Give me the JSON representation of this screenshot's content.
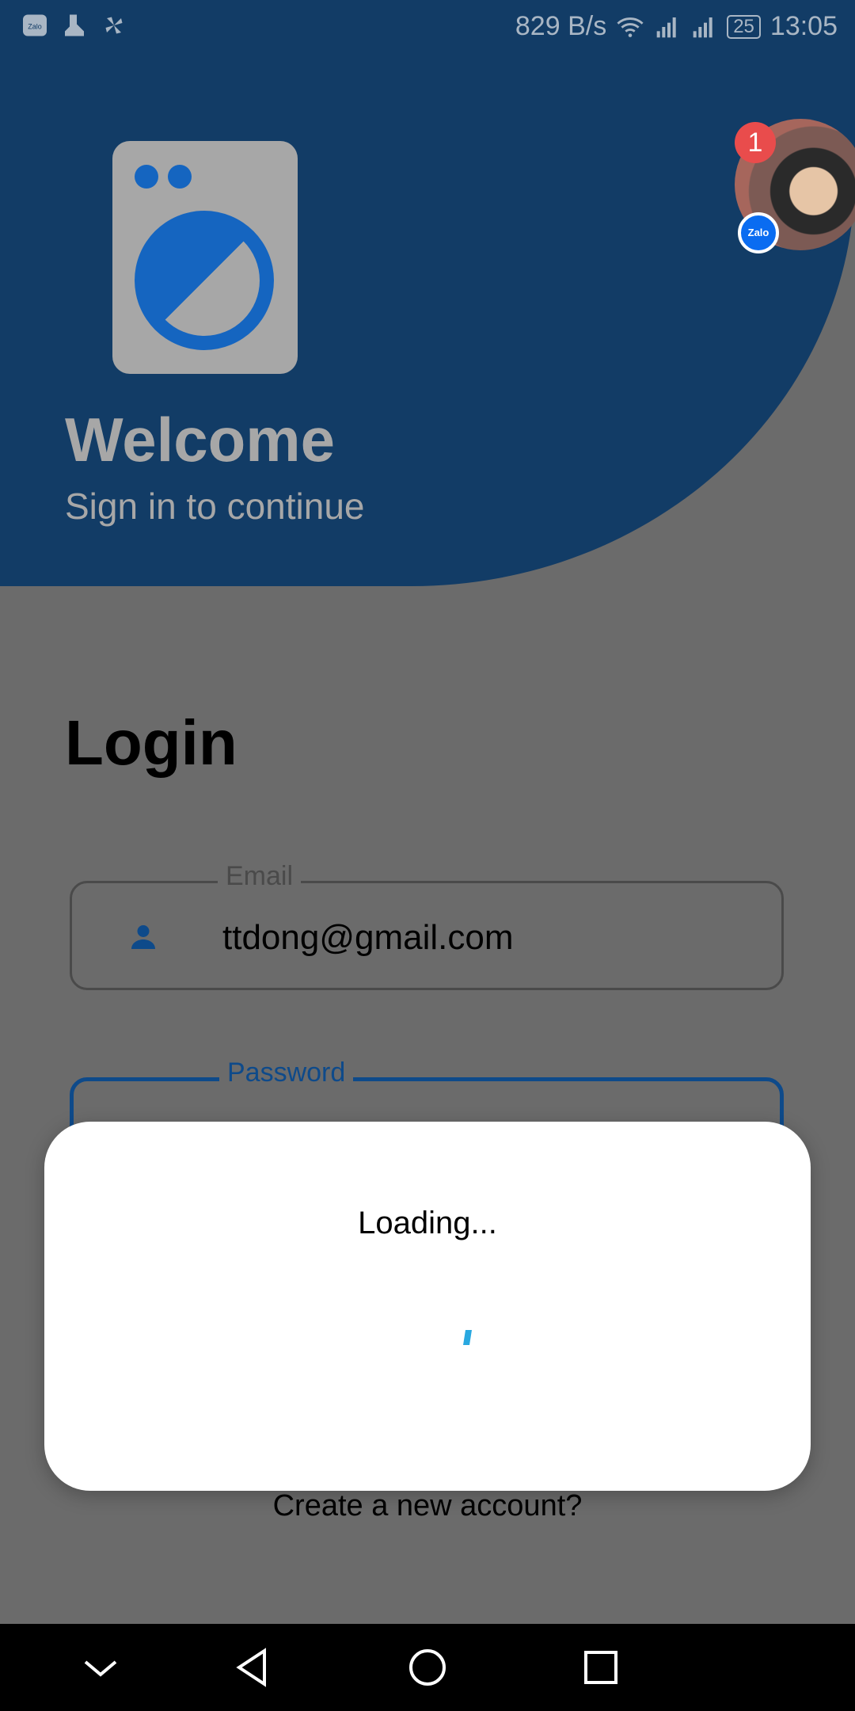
{
  "status_bar": {
    "net_speed": "829 B/s",
    "battery": "25",
    "time": "13:05",
    "left_icons": [
      "zalo-icon",
      "app-icon",
      "fan-icon"
    ],
    "right_icons": [
      "wifi-icon",
      "signal-icon",
      "signal-icon",
      "battery-icon"
    ]
  },
  "hero": {
    "title": "Welcome",
    "subtitle": "Sign in to continue"
  },
  "login": {
    "title": "Login",
    "email_label": "Email",
    "email_value": "ttdong@gmail.com",
    "password_label": "Password",
    "create_account": "Create a new account?"
  },
  "chathead": {
    "badge_count": "1",
    "app_label": "Zalo"
  },
  "dialog": {
    "message": "Loading..."
  },
  "colors": {
    "primary": "#1565c0",
    "scrim_gray": "#6b6b6b",
    "badge_red": "#e94c4c",
    "spinner": "#29a8e0"
  }
}
